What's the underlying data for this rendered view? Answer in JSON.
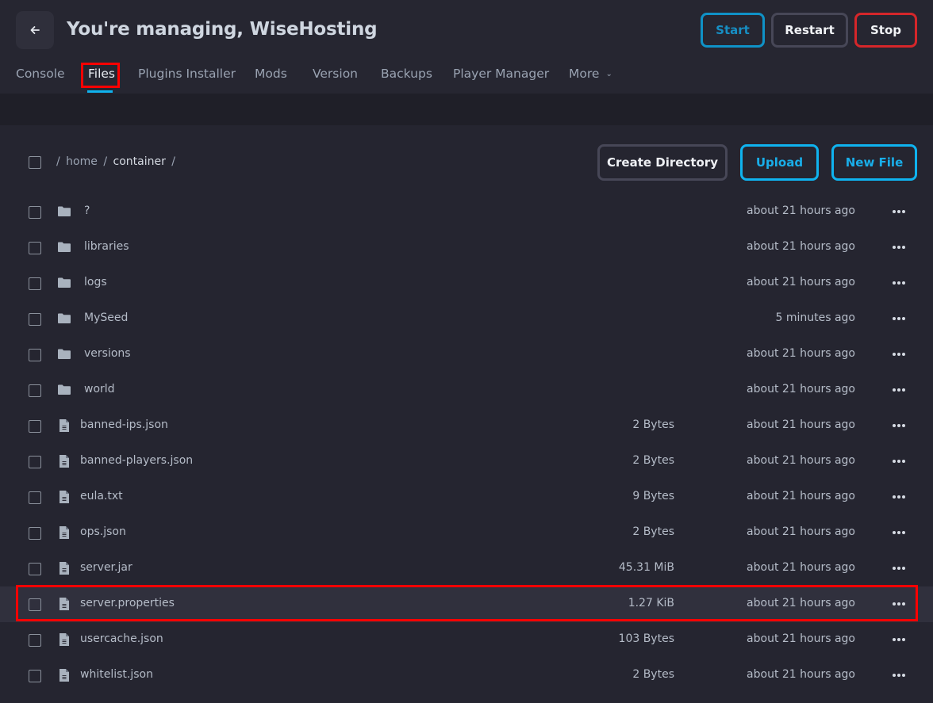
{
  "header": {
    "title": "You're managing, WiseHosting",
    "back_icon": "arrow-left-icon",
    "power_buttons": {
      "start": "Start",
      "restart": "Restart",
      "stop": "Stop"
    }
  },
  "tabs": [
    {
      "label": "Console",
      "active": false
    },
    {
      "label": "Files",
      "active": true
    },
    {
      "label": "Plugins Installer",
      "active": false
    },
    {
      "label": "Mods",
      "active": false
    },
    {
      "label": "Version",
      "active": false
    },
    {
      "label": "Backups",
      "active": false
    },
    {
      "label": "Player Manager",
      "active": false
    },
    {
      "label": "More",
      "active": false,
      "dropdown": true
    }
  ],
  "file_manager": {
    "breadcrumb": [
      {
        "label": "home",
        "active": false
      },
      {
        "label": "container",
        "active": true
      }
    ],
    "breadcrumb_separator": "/",
    "actions": {
      "create_directory": "Create Directory",
      "upload": "Upload",
      "new_file": "New File"
    },
    "entries": [
      {
        "type": "folder",
        "name": "?",
        "size": "",
        "modified": "about 21 hours ago"
      },
      {
        "type": "folder",
        "name": "libraries",
        "size": "",
        "modified": "about 21 hours ago"
      },
      {
        "type": "folder",
        "name": "logs",
        "size": "",
        "modified": "about 21 hours ago"
      },
      {
        "type": "folder",
        "name": "MySeed",
        "size": "",
        "modified": "5 minutes ago"
      },
      {
        "type": "folder",
        "name": "versions",
        "size": "",
        "modified": "about 21 hours ago"
      },
      {
        "type": "folder",
        "name": "world",
        "size": "",
        "modified": "about 21 hours ago"
      },
      {
        "type": "file",
        "name": "banned-ips.json",
        "size": "2 Bytes",
        "modified": "about 21 hours ago"
      },
      {
        "type": "file",
        "name": "banned-players.json",
        "size": "2 Bytes",
        "modified": "about 21 hours ago"
      },
      {
        "type": "file",
        "name": "eula.txt",
        "size": "9 Bytes",
        "modified": "about 21 hours ago"
      },
      {
        "type": "file",
        "name": "ops.json",
        "size": "2 Bytes",
        "modified": "about 21 hours ago"
      },
      {
        "type": "file",
        "name": "server.jar",
        "size": "45.31 MiB",
        "modified": "about 21 hours ago"
      },
      {
        "type": "file",
        "name": "server.properties",
        "size": "1.27 KiB",
        "modified": "about 21 hours ago",
        "highlighted": true
      },
      {
        "type": "file",
        "name": "usercache.json",
        "size": "103 Bytes",
        "modified": "about 21 hours ago"
      },
      {
        "type": "file",
        "name": "whitelist.json",
        "size": "2 Bytes",
        "modified": "about 21 hours ago"
      }
    ]
  },
  "colors": {
    "accent": "#0fb3ef",
    "start": "#0f92c7",
    "danger": "#d5262a",
    "highlight_annotation": "#ff0000",
    "background": "#252530"
  }
}
